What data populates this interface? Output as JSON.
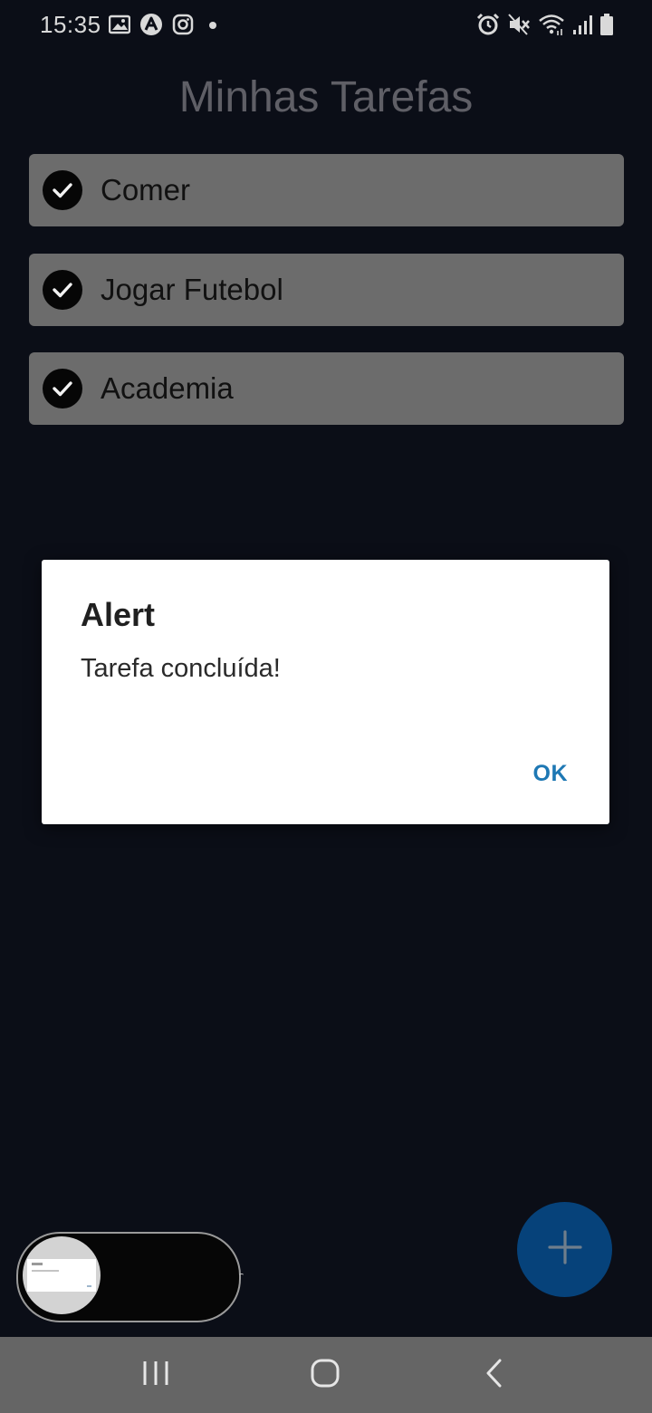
{
  "status_bar": {
    "time": "15:35",
    "left_icons": [
      "gallery-icon",
      "app-a-icon",
      "instagram-icon",
      "dot-icon"
    ],
    "right_icons": [
      "alarm-icon",
      "mute-icon",
      "wifi-icon",
      "signal-icon",
      "battery-icon"
    ]
  },
  "header": {
    "title": "Minhas Tarefas"
  },
  "tasks": [
    {
      "label": "Comer",
      "completed": true
    },
    {
      "label": "Jogar Futebol",
      "completed": true
    },
    {
      "label": "Academia",
      "completed": true
    }
  ],
  "alert": {
    "title": "Alert",
    "message": "Tarefa concluída!",
    "ok_label": "OK"
  },
  "fab": {
    "icon": "plus-icon"
  },
  "nav_bar": {
    "buttons": [
      "recent-apps-icon",
      "home-icon",
      "back-icon"
    ]
  },
  "colors": {
    "background": "#0b0e17",
    "task_item": "#6c6c6c",
    "title_text": "#5f5f66",
    "accent": "#1e78b4",
    "fab": "#06427a",
    "nav_bar": "#656565"
  }
}
